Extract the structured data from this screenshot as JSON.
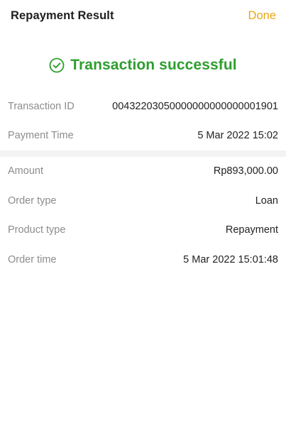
{
  "header": {
    "title": "Repayment Result",
    "done_label": "Done"
  },
  "status": {
    "icon": "check-circle-icon",
    "text": "Transaction successful",
    "color": "#2e9e2e"
  },
  "transaction_section": {
    "rows": [
      {
        "label": "Transaction ID",
        "value": "00432203050000000000000001901"
      },
      {
        "label": "Payment Time",
        "value": "5 Mar 2022 15:02"
      }
    ]
  },
  "order_section": {
    "rows": [
      {
        "label": "Amount",
        "value": "Rp893,000.00"
      },
      {
        "label": "Order type",
        "value": "Loan"
      },
      {
        "label": "Product type",
        "value": "Repayment"
      },
      {
        "label": "Order time",
        "value": "5 Mar 2022 15:01:48"
      }
    ]
  },
  "colors": {
    "accent": "#e9a814",
    "success": "#2e9e2e"
  }
}
